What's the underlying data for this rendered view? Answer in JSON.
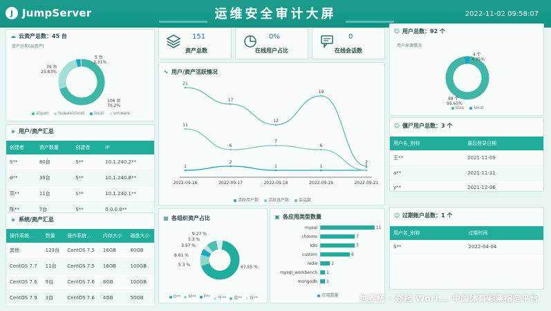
{
  "header": {
    "logo_mark": "J",
    "logo": "JumpServer",
    "title": "运维安全审计大屏",
    "datetime": "2022-11-02 09:58:07"
  },
  "cloud": {
    "title": "云资产总数：45 台",
    "subtitle": "资产分布(云资产)",
    "slices": [
      {
        "name": "aliyun",
        "value_label": "106 台",
        "pct": "70.2%",
        "value": 70.2,
        "color": "#3fb7a6"
      },
      {
        "name": "huaweicloud",
        "value_label": "39 台",
        "pct": "25.83%",
        "value": 25.83,
        "color": "#9fe0d4"
      },
      {
        "name": "local",
        "value_label": "5 台",
        "pct": "3.31%",
        "value": 3.31,
        "color": "#1aa6c7"
      },
      {
        "name": "vmware",
        "value_label": "",
        "pct": "",
        "value": 0.66,
        "color": "#d0ece6"
      }
    ],
    "legend": [
      "aliyun",
      "huaweicloud",
      "local",
      "vmware"
    ]
  },
  "user_asset": {
    "title": "用户/资产汇总",
    "headers": [
      "创建者",
      "资产数量",
      "创建者",
      "IP"
    ],
    "rows": [
      [
        "S**",
        "80台",
        "S**",
        "10.1.240.2**"
      ],
      [
        "d**",
        "39台",
        "S**",
        "10.1.240.8**"
      ],
      [
        "高**",
        "11台",
        "S**",
        "10.1.240.1**"
      ],
      [
        "陈**",
        "7台",
        "S**",
        "0.0.0.0**"
      ]
    ]
  },
  "system": {
    "title": "系统/资产汇总",
    "headers": [
      "操作系统...",
      "数量",
      "操作系统...",
      "内存大小",
      "磁盘大小"
    ],
    "rows": [
      [
        "其他",
        "123台",
        "CentOS 7.5",
        "16GB",
        "80GB"
      ],
      [
        "CentOS 7.7",
        "11台",
        "CentOS 7.5",
        "16GB",
        "100GB"
      ],
      [
        "CentOS 7.6",
        "9台",
        "CentOS 7.6",
        "8GB",
        "100GB"
      ],
      [
        "CentOS 7.9",
        "3台",
        "CentOS 7.6",
        "4GB",
        "50GB"
      ]
    ]
  },
  "stats": [
    {
      "value": "151",
      "label": "资产总数",
      "icon": "layers-icon"
    },
    {
      "value": "0%",
      "label": "在线用户占比",
      "icon": "pie-icon"
    },
    {
      "value": "0",
      "label": "在线会话数",
      "icon": "chat-icon"
    }
  ],
  "activity": {
    "title": "用户/资产活跃情况",
    "legend": [
      "活跃用户数",
      "活跃资产数",
      "会话数"
    ]
  },
  "org": {
    "title": "各组织资产占比",
    "legend": [
      "D**",
      "M**",
      "F**",
      "牛**",
      "成**",
      "线**"
    ]
  },
  "app_types": {
    "title": "各应用类型数量",
    "axis_label": "应用数量"
  },
  "users": {
    "title": "用户总数：92 个",
    "subtitle": "用户来源情况",
    "legend": [
      "ldap",
      "local"
    ]
  },
  "priv_users": {
    "title": "僵尸用户总数：3 个",
    "headers": [
      "用户名_别称",
      "最后登录日期"
    ],
    "rows": [
      [
        "王**",
        "2021-11-09"
      ],
      [
        "a**",
        "2021-11-11"
      ],
      [
        "y**",
        "2021-12-06"
      ]
    ]
  },
  "expired": {
    "title": "过期账户总数：1 个",
    "headers": [
      "用户名_别称",
      "过期时间"
    ],
    "rows": [
      [
        "S**",
        "2022-04-04"
      ]
    ]
  },
  "watermark": "世界杯 · 夺冠 Worl...  中国体育彩票指定平台",
  "chart_data": [
    {
      "type": "pie",
      "categories": [
        "aliyun",
        "huaweicloud",
        "local",
        "vmware"
      ],
      "values": [
        106,
        39,
        5,
        1
      ]
    },
    {
      "type": "line",
      "categories": [
        "2022-09-16",
        "2022-09-17",
        "2022-09-18",
        "2022-09-19",
        "2022-09-21"
      ],
      "series": [
        {
          "name": "活跃用户数",
          "values": [
            1,
            2,
            1,
            1,
            1
          ]
        },
        {
          "name": "活跃资产数",
          "values": [
            11,
            6,
            7,
            6,
            1
          ]
        },
        {
          "name": "会话数",
          "values": [
            21,
            17,
            12,
            19,
            2
          ]
        }
      ],
      "ylim": [
        0,
        22
      ]
    },
    {
      "type": "pie",
      "categories": [
        "D**",
        "M**",
        "F**",
        "牛**",
        "成**",
        "线**"
      ],
      "values": [
        67.55,
        9.27,
        5.3,
        3.97,
        8.61,
        5.3
      ],
      "labels": [
        "67.55 %",
        "9.27 %",
        "5.3 %",
        "3.97 %",
        "8.61 %",
        "5.3 %"
      ]
    },
    {
      "type": "bar",
      "categories": [
        "mysql",
        "chrome",
        "k8s",
        "custom",
        "redis",
        "mysql_workbench",
        "mongodb"
      ],
      "values": [
        11,
        7,
        7,
        6,
        2,
        1,
        1
      ],
      "xlabel": "应用数量",
      "xlim": [
        0,
        12
      ]
    },
    {
      "type": "pie",
      "categories": [
        "ldap",
        "local"
      ],
      "values": [
        88,
        4
      ],
      "labels": [
        "88 个 95.65%",
        "4 个 4.35%"
      ]
    }
  ]
}
